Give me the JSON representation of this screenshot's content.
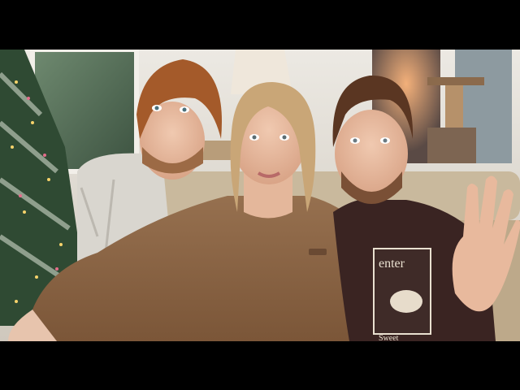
{
  "scene": {
    "shirt_print_top": "enter",
    "shirt_print_bottom": "Sweet",
    "colors": {
      "letterbox": "#000000",
      "wall": "#dedad3",
      "sofa": "#c9b99d",
      "brown_sweatshirt": "#8a6244",
      "dark_sweatshirt": "#3a2422",
      "tree_green": "#2f4a33"
    }
  }
}
